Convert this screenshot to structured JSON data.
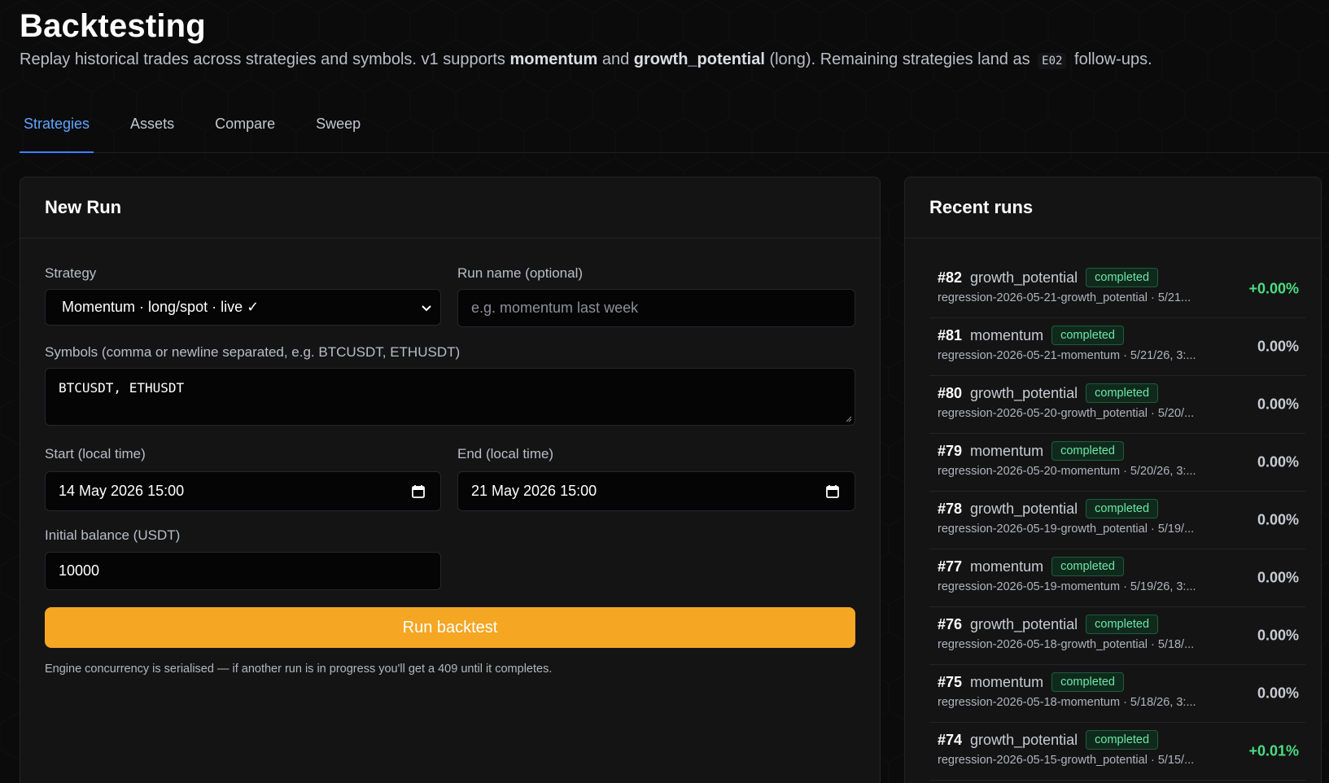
{
  "header": {
    "title": "Backtesting",
    "subtitle_pre": "Replay historical trades across strategies and symbols. v1 supports ",
    "subtitle_b1": "momentum",
    "subtitle_mid": " and ",
    "subtitle_b2": "growth_potential",
    "subtitle_post": " (long). Remaining strategies land as ",
    "subtitle_code": "E02",
    "subtitle_end": " follow-ups."
  },
  "tabs": [
    "Strategies",
    "Assets",
    "Compare",
    "Sweep"
  ],
  "new_run": {
    "title": "New Run",
    "strategy_label": "Strategy",
    "strategy_value": "Momentum · long/spot · live ✓",
    "run_name_label": "Run name (optional)",
    "run_name_placeholder": "e.g. momentum last week",
    "symbols_label": "Symbols (comma or newline separated, e.g. BTCUSDT, ETHUSDT)",
    "symbols_value": "BTCUSDT, ETHUSDT",
    "start_label": "Start (local time)",
    "start_value": "14 May 2026 15:00",
    "end_label": "End (local time)",
    "end_value": "21 May 2026 15:00",
    "balance_label": "Initial balance (USDT)",
    "balance_value": "10000",
    "run_button": "Run backtest",
    "hint": "Engine concurrency is serialised — if another run is in progress you'll get a 409 until it completes."
  },
  "recent_runs": {
    "title": "Recent runs",
    "items": [
      {
        "id": "#82",
        "strategy": "growth_potential",
        "status": "completed",
        "sub": "regression-2026-05-21-growth_potential · 5/21...",
        "pnl": "+0.00%",
        "positive": true
      },
      {
        "id": "#81",
        "strategy": "momentum",
        "status": "completed",
        "sub": "regression-2026-05-21-momentum · 5/21/26, 3:...",
        "pnl": "0.00%",
        "positive": false
      },
      {
        "id": "#80",
        "strategy": "growth_potential",
        "status": "completed",
        "sub": "regression-2026-05-20-growth_potential · 5/20/...",
        "pnl": "0.00%",
        "positive": false
      },
      {
        "id": "#79",
        "strategy": "momentum",
        "status": "completed",
        "sub": "regression-2026-05-20-momentum · 5/20/26, 3:...",
        "pnl": "0.00%",
        "positive": false
      },
      {
        "id": "#78",
        "strategy": "growth_potential",
        "status": "completed",
        "sub": "regression-2026-05-19-growth_potential · 5/19/...",
        "pnl": "0.00%",
        "positive": false
      },
      {
        "id": "#77",
        "strategy": "momentum",
        "status": "completed",
        "sub": "regression-2026-05-19-momentum · 5/19/26, 3:...",
        "pnl": "0.00%",
        "positive": false
      },
      {
        "id": "#76",
        "strategy": "growth_potential",
        "status": "completed",
        "sub": "regression-2026-05-18-growth_potential · 5/18/...",
        "pnl": "0.00%",
        "positive": false
      },
      {
        "id": "#75",
        "strategy": "momentum",
        "status": "completed",
        "sub": "regression-2026-05-18-momentum · 5/18/26, 3:...",
        "pnl": "0.00%",
        "positive": false
      },
      {
        "id": "#74",
        "strategy": "growth_potential",
        "status": "completed",
        "sub": "regression-2026-05-15-growth_potential · 5/15/...",
        "pnl": "+0.01%",
        "positive": true
      }
    ]
  },
  "colors": {
    "accent_blue": "#60a5fa",
    "button_orange": "#f5a623",
    "positive_green": "#4ade80",
    "badge_green": "#6ee7a8"
  },
  "icons": [
    "chevron-down-icon",
    "calendar-icon"
  ]
}
